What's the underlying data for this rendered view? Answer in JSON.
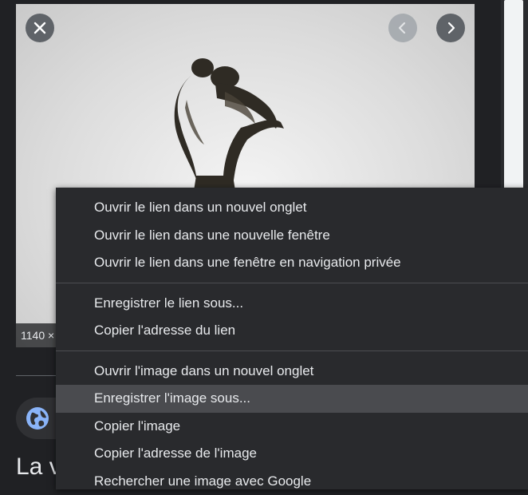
{
  "viewer": {
    "dimensions_label": "1140 ×",
    "close_icon": "close-icon",
    "prev_icon": "chevron-left-icon",
    "next_icon": "chevron-right-icon"
  },
  "page": {
    "title": "La v",
    "source_icon": "globe-icon"
  },
  "context_menu": {
    "groups": [
      [
        "Ouvrir le lien dans un nouvel onglet",
        "Ouvrir le lien dans une nouvelle fenêtre",
        "Ouvrir le lien dans une fenêtre en navigation privée"
      ],
      [
        "Enregistrer le lien sous...",
        "Copier l'adresse du lien"
      ],
      [
        "Ouvrir l'image dans un nouvel onglet",
        "Enregistrer l'image sous...",
        "Copier l'image",
        "Copier l'adresse de l'image",
        "Rechercher une image avec Google"
      ]
    ],
    "highlighted_item": "Enregistrer l'image sous..."
  },
  "colors": {
    "background": "#202124",
    "menu_background": "#292a2d",
    "menu_highlight": "#4a4b4f",
    "menu_text": "#e8eaed",
    "globe_blue": "#8ab4f8"
  }
}
